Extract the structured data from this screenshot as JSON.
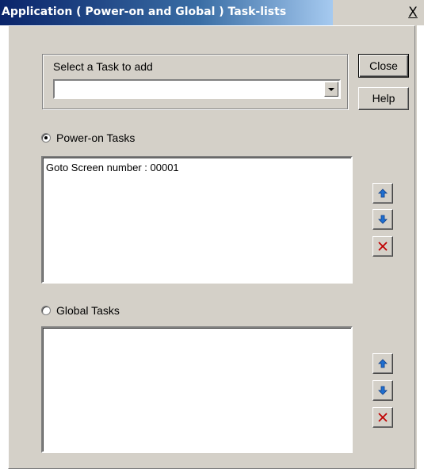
{
  "window": {
    "title": "Application ( Power-on and Global ) Task-lists",
    "close_glyph": "X"
  },
  "task_select": {
    "label": "Select a Task to add",
    "value": ""
  },
  "buttons": {
    "close_label": "Close",
    "help_label": "Help"
  },
  "power_on": {
    "label": "Power-on Tasks",
    "selected": true,
    "items": [
      "Goto Screen number : 00001"
    ]
  },
  "global": {
    "label": "Global Tasks",
    "selected": false,
    "items": []
  },
  "icons": {
    "up": "arrow-up-icon",
    "down": "arrow-down-icon",
    "delete": "delete-x-icon"
  },
  "colors": {
    "title_bar_start": "#0a246a",
    "title_bar_end": "#a6caf0",
    "face": "#d4d0c8",
    "arrow_blue": "#1f6fd0",
    "delete_red": "#c00000"
  }
}
